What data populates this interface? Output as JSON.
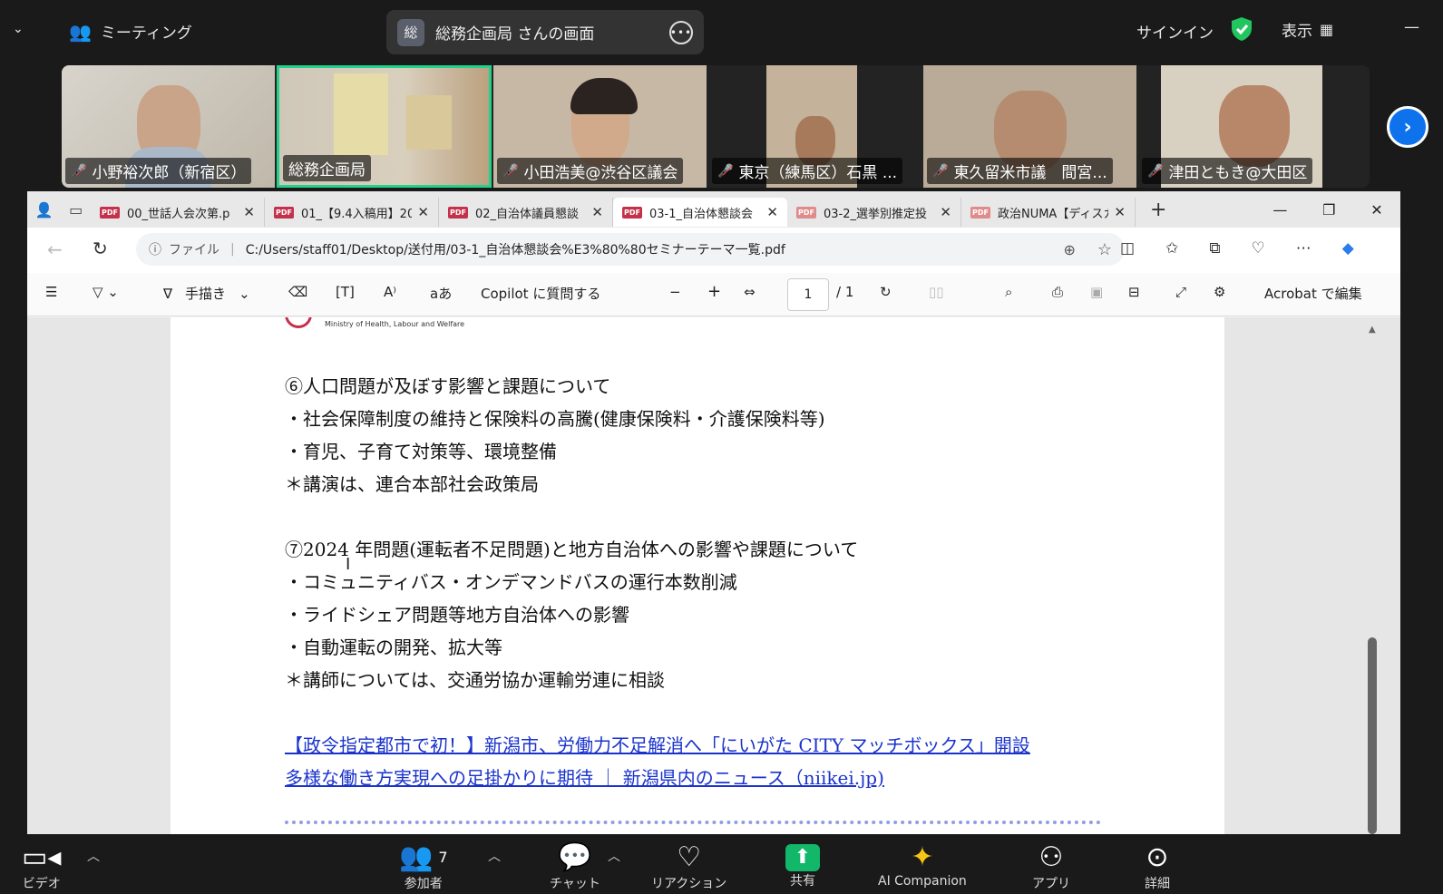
{
  "zoom_topbar": {
    "meeting_label": "ミーティング",
    "share_initial": "総",
    "share_label": "総務企画局 さんの画面",
    "signin": "サインイン",
    "view": "表示"
  },
  "participants": [
    {
      "name": "小野裕次郎（新宿区）",
      "muted": true
    },
    {
      "name": "総務企画局",
      "muted": false,
      "active": true
    },
    {
      "name": "小田浩美@渋谷区議会",
      "muted": true
    },
    {
      "name": "東京（練馬区）石黒 ...",
      "muted": true
    },
    {
      "name": "東久留米市議　間宮...",
      "muted": true
    },
    {
      "name": "津田ともき@大田区",
      "muted": true
    }
  ],
  "browser": {
    "tabs": [
      {
        "title": "00_世話人会次第.p"
      },
      {
        "title": "01_【9.4入稿用】202"
      },
      {
        "title": "02_自治体議員懇談"
      },
      {
        "title": "03-1_自治体懇談会",
        "active": true
      },
      {
        "title": "03-2_選挙別推定投"
      },
      {
        "title": "政治NUMA【ディスカ"
      }
    ],
    "address_prefix": "ファイル",
    "address": "C:/Users/staff01/Desktop/送付用/03-1_自治体懇談会%E3%80%80セミナーテーマ一覧.pdf"
  },
  "pdf_toolbar": {
    "draw": "手描き",
    "copilot": "Copilot に質問する",
    "page_current": "1",
    "page_total": "/ 1",
    "acrobat": "Acrobat で編集",
    "aa": "aあ"
  },
  "document": {
    "logo_sub": "Ministry of Health, Labour and Welfare",
    "lines": [
      "⑥人口問題が及ぼす影響と課題について",
      "・社会保障制度の維持と保険料の高騰(健康保険料・介護保険料等)",
      "・育児、子育て対策等、環境整備",
      "＊講演は、連合本部社会政策局",
      "⑦2024 年問題(運転者不足問題)と地方自治体への影響や課題について",
      "・コミュニティバス・オンデマンドバスの運行本数削減",
      "・ライドシェア問題等地方自治体への影響",
      "・自動運転の開発、拡大等",
      "＊講師については、交通労協か運輸労連に相談"
    ],
    "link_lines": [
      "【政令指定都市で初！】新潟市、労働力不足解消へ「にいがた CITY マッチボックス」開設",
      "多様な働き方実現への足掛かりに期待 ｜ 新潟県内のニュース（niikei.jp)"
    ]
  },
  "zoom_bottombar": {
    "video": "ビデオ",
    "participants": "参加者",
    "participants_count": "7",
    "chat": "チャット",
    "reactions": "リアクション",
    "share": "共有",
    "ai": "AI Companion",
    "apps": "アプリ",
    "more": "詳細"
  }
}
